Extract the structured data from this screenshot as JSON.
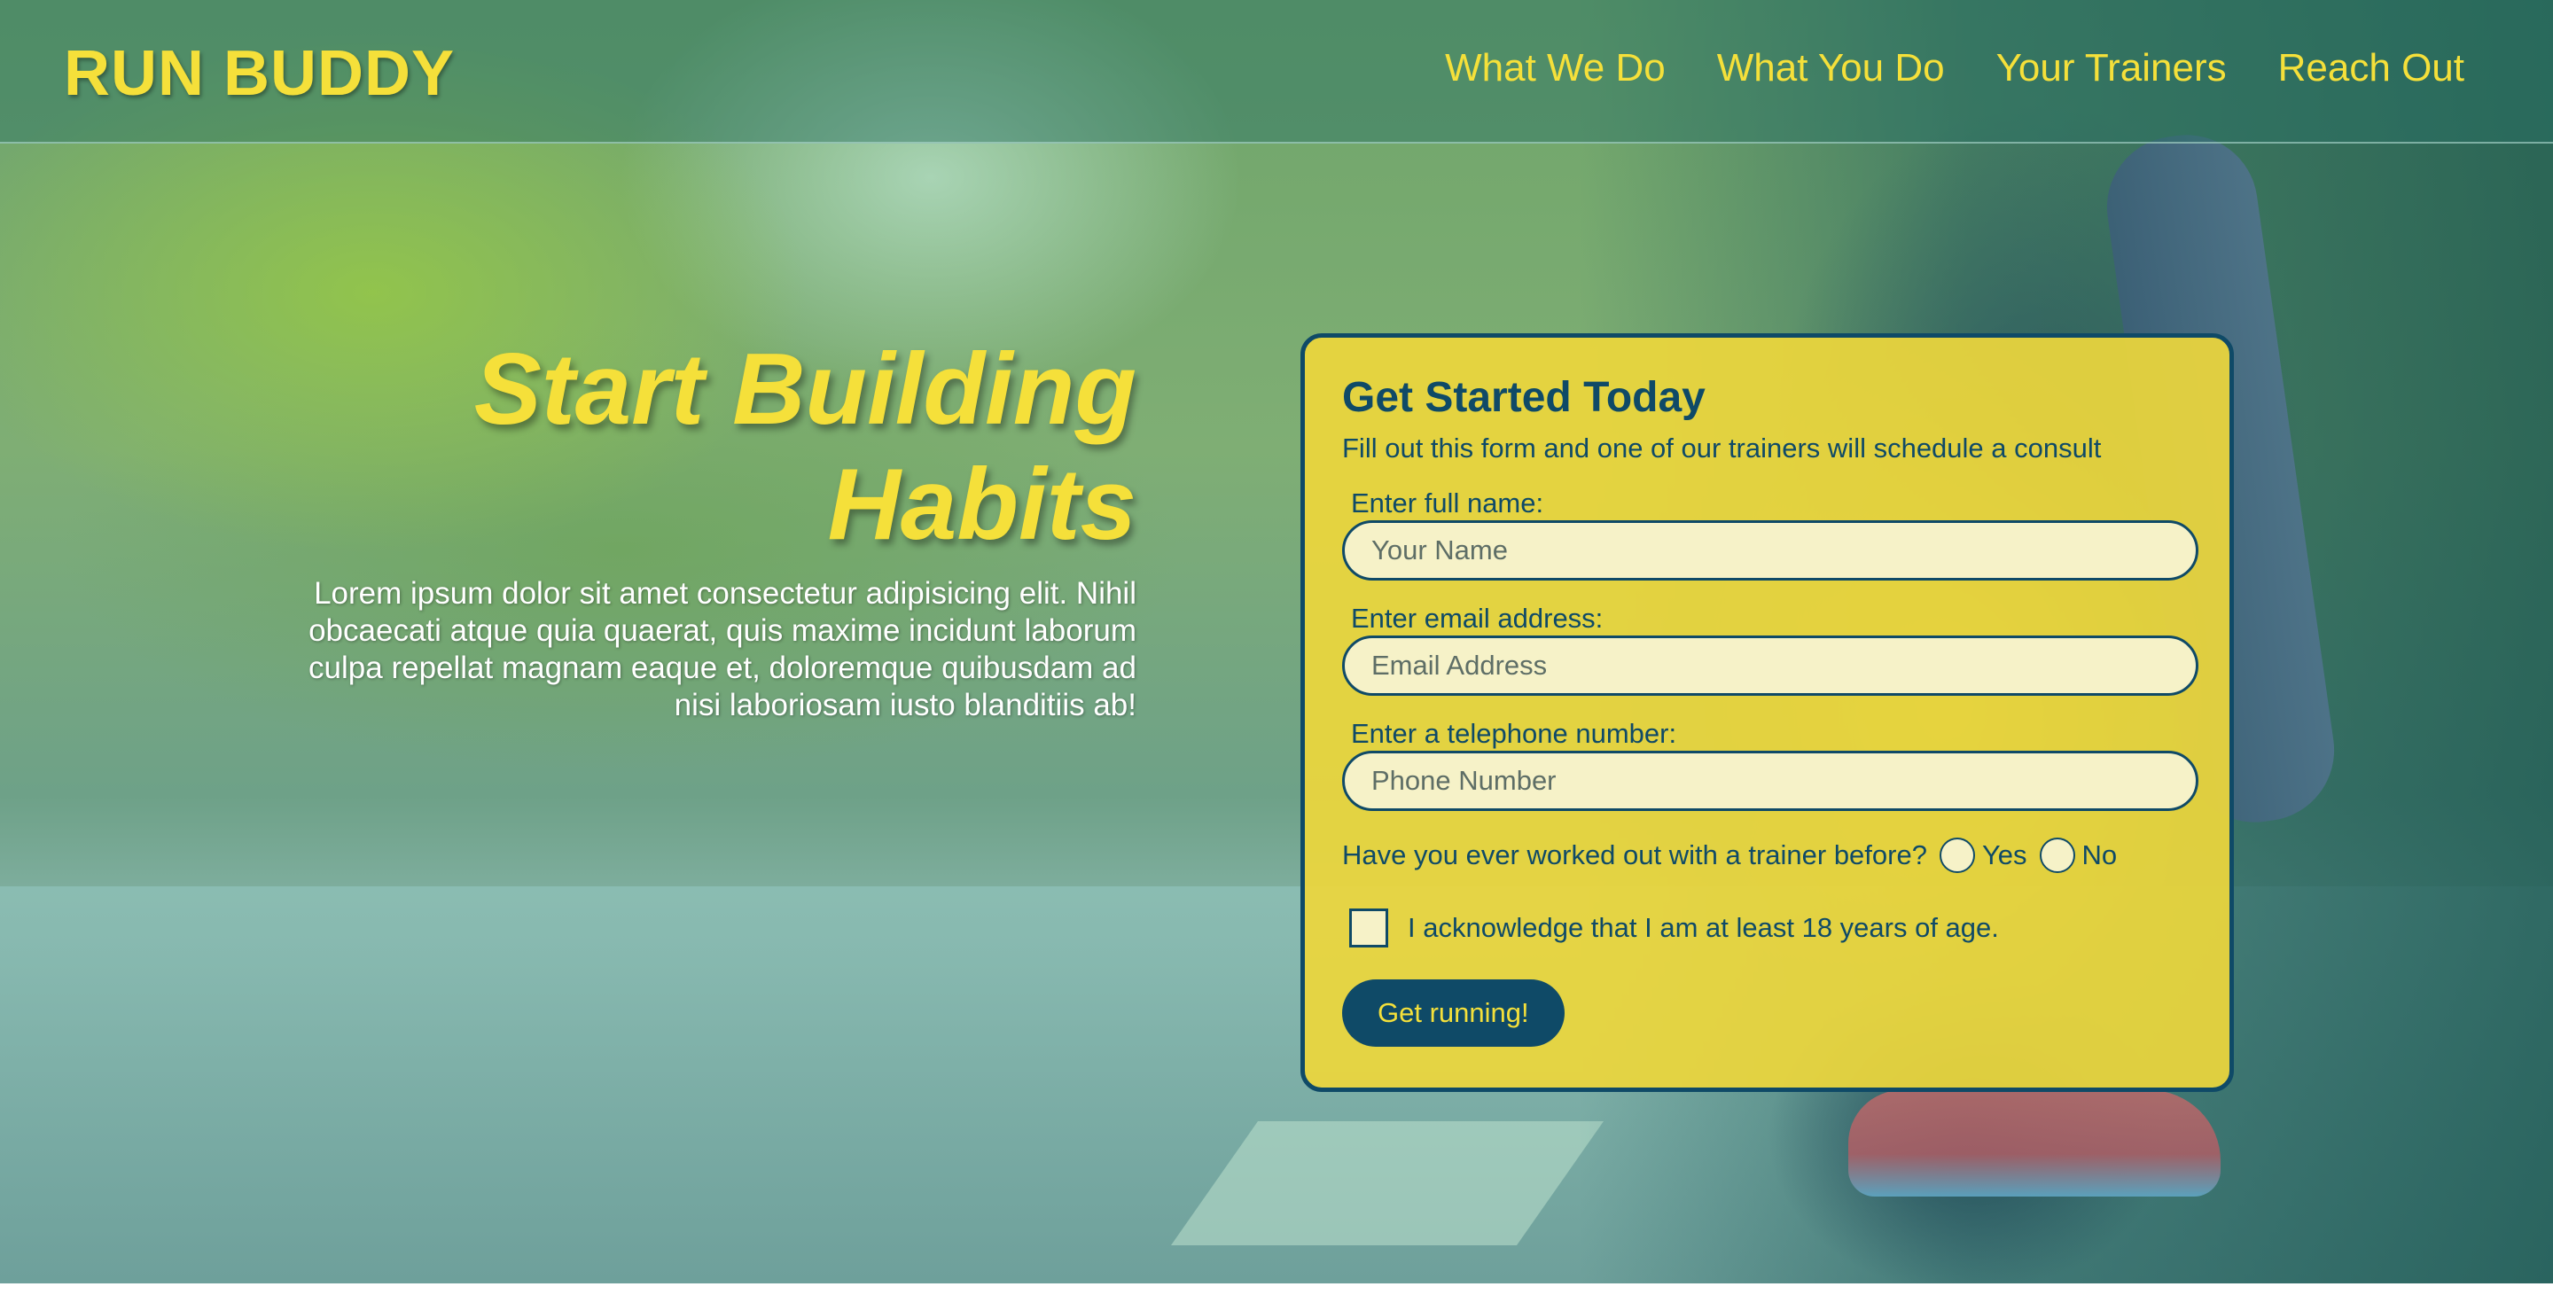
{
  "header": {
    "brand": "RUN BUDDY",
    "nav": [
      {
        "label": "What We Do"
      },
      {
        "label": "What You Do"
      },
      {
        "label": "Your Trainers"
      },
      {
        "label": "Reach Out"
      }
    ]
  },
  "hero": {
    "title": "Start Building Habits",
    "body": "Lorem ipsum dolor sit amet consectetur adipisicing elit. Nihil obcaecati atque quia quaerat, quis maxime incidunt laborum culpa repellat magnam eaque et, doloremque quibusdam ad nisi laboriosam iusto blanditiis ab!"
  },
  "form": {
    "title": "Get Started Today",
    "subtitle": "Fill out this form and one of our trainers will schedule a consult",
    "fields": [
      {
        "label": "Enter full name:",
        "placeholder": "Your Name",
        "value": ""
      },
      {
        "label": "Enter email address:",
        "placeholder": "Email Address",
        "value": ""
      },
      {
        "label": "Enter a telephone number:",
        "placeholder": "Phone Number",
        "value": ""
      }
    ],
    "trainer_question": "Have you ever worked out with a trainer before?",
    "radio_options": [
      {
        "label": "Yes",
        "selected": false
      },
      {
        "label": "No",
        "selected": false
      }
    ],
    "age_checkbox": {
      "label": "I acknowledge that I am at least 18 years of age.",
      "checked": false
    },
    "submit_label": "Get running!"
  },
  "colors": {
    "accent_yellow": "#f5e03a",
    "dark_blue": "#0f4a67",
    "input_bg": "#f6f2c8"
  }
}
